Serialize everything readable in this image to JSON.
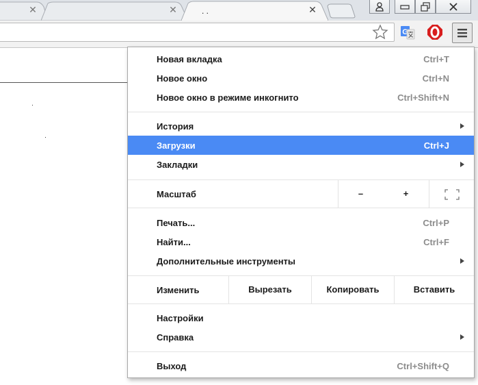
{
  "window": {
    "tabs": [
      {
        "title": ""
      },
      {
        "title": ""
      },
      {
        "title": ". ."
      }
    ],
    "controls": [
      "user-icon",
      "minimize-icon",
      "restore-icon",
      "close-icon"
    ]
  },
  "toolbar": {
    "icons": [
      "bookmark-star-icon",
      "google-translate-icon",
      "adblock-icon",
      "chrome-menu-icon"
    ]
  },
  "menu": {
    "new_tab": {
      "label": "Новая вкладка",
      "shortcut": "Ctrl+T"
    },
    "new_window": {
      "label": "Новое окно",
      "shortcut": "Ctrl+N"
    },
    "incognito": {
      "label": "Новое окно в режиме инкогнито",
      "shortcut": "Ctrl+Shift+N"
    },
    "history": {
      "label": "История"
    },
    "downloads": {
      "label": "Загрузки",
      "shortcut": "Ctrl+J"
    },
    "bookmarks": {
      "label": "Закладки"
    },
    "zoom": {
      "label": "Масштаб",
      "minus": "–",
      "plus": "+"
    },
    "print": {
      "label": "Печать...",
      "shortcut": "Ctrl+P"
    },
    "find": {
      "label": "Найти...",
      "shortcut": "Ctrl+F"
    },
    "more_tools": {
      "label": "Дополнительные инструменты"
    },
    "edit": {
      "label": "Изменить",
      "cut": "Вырезать",
      "copy": "Копировать",
      "paste": "Вставить"
    },
    "settings": {
      "label": "Настройки"
    },
    "help": {
      "label": "Справка"
    },
    "exit": {
      "label": "Выход",
      "shortcut": "Ctrl+Shift+Q"
    }
  },
  "colors": {
    "highlight": "#4a8af4",
    "shortcut_text": "#8c8c8c"
  }
}
